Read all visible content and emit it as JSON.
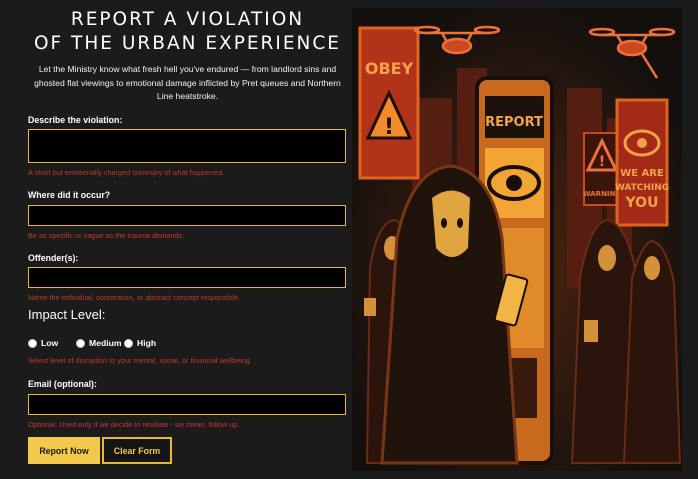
{
  "header": {
    "title_line1": "REPORT A VIOLATION",
    "title_line2": "OF THE URBAN EXPERIENCE",
    "intro_line1": "Let the Ministry know what fresh hell you've endured — from landlord sins and",
    "intro_line2": "ghosted flat viewings to emotional damage inflicted by Pret queues and Northern",
    "intro_line3": "Line heatstroke."
  },
  "form": {
    "violation": {
      "label": "Describe the violation:",
      "value": "",
      "help": "A short but emotionally charged summary of what happened."
    },
    "location": {
      "label": "Where did it occur?",
      "value": "",
      "help": "Be as specific or vague as the trauma demands."
    },
    "offender": {
      "label": "Offender(s):",
      "value": "",
      "help": "Name the individual, corporation, or abstract concept responsible."
    },
    "impact": {
      "label": "Impact Level:",
      "options": [
        "Low",
        "Medium",
        "High"
      ],
      "help": "Select level of disruption to your mental, social, or financial wellbeing."
    },
    "email": {
      "label": "Email (optional):",
      "value": "",
      "help": "Optional. Used only if we decide to retaliate - we mean, follow up."
    },
    "buttons": {
      "submit": "Report Now",
      "clear": "Clear Form"
    }
  },
  "poster": {
    "sign_obey": "OBEY",
    "booth_sign": "REPORT",
    "warning_sign": "WARNING",
    "watching_line1": "WE ARE",
    "watching_line2": "WATCHING",
    "watching_line3": "YOU"
  },
  "colors": {
    "accent": "#f2c94c",
    "field_border": "#e6b93a",
    "help_text": "#c0392b",
    "background": "#1b1b1b",
    "poster_orange": "#e0641d"
  }
}
